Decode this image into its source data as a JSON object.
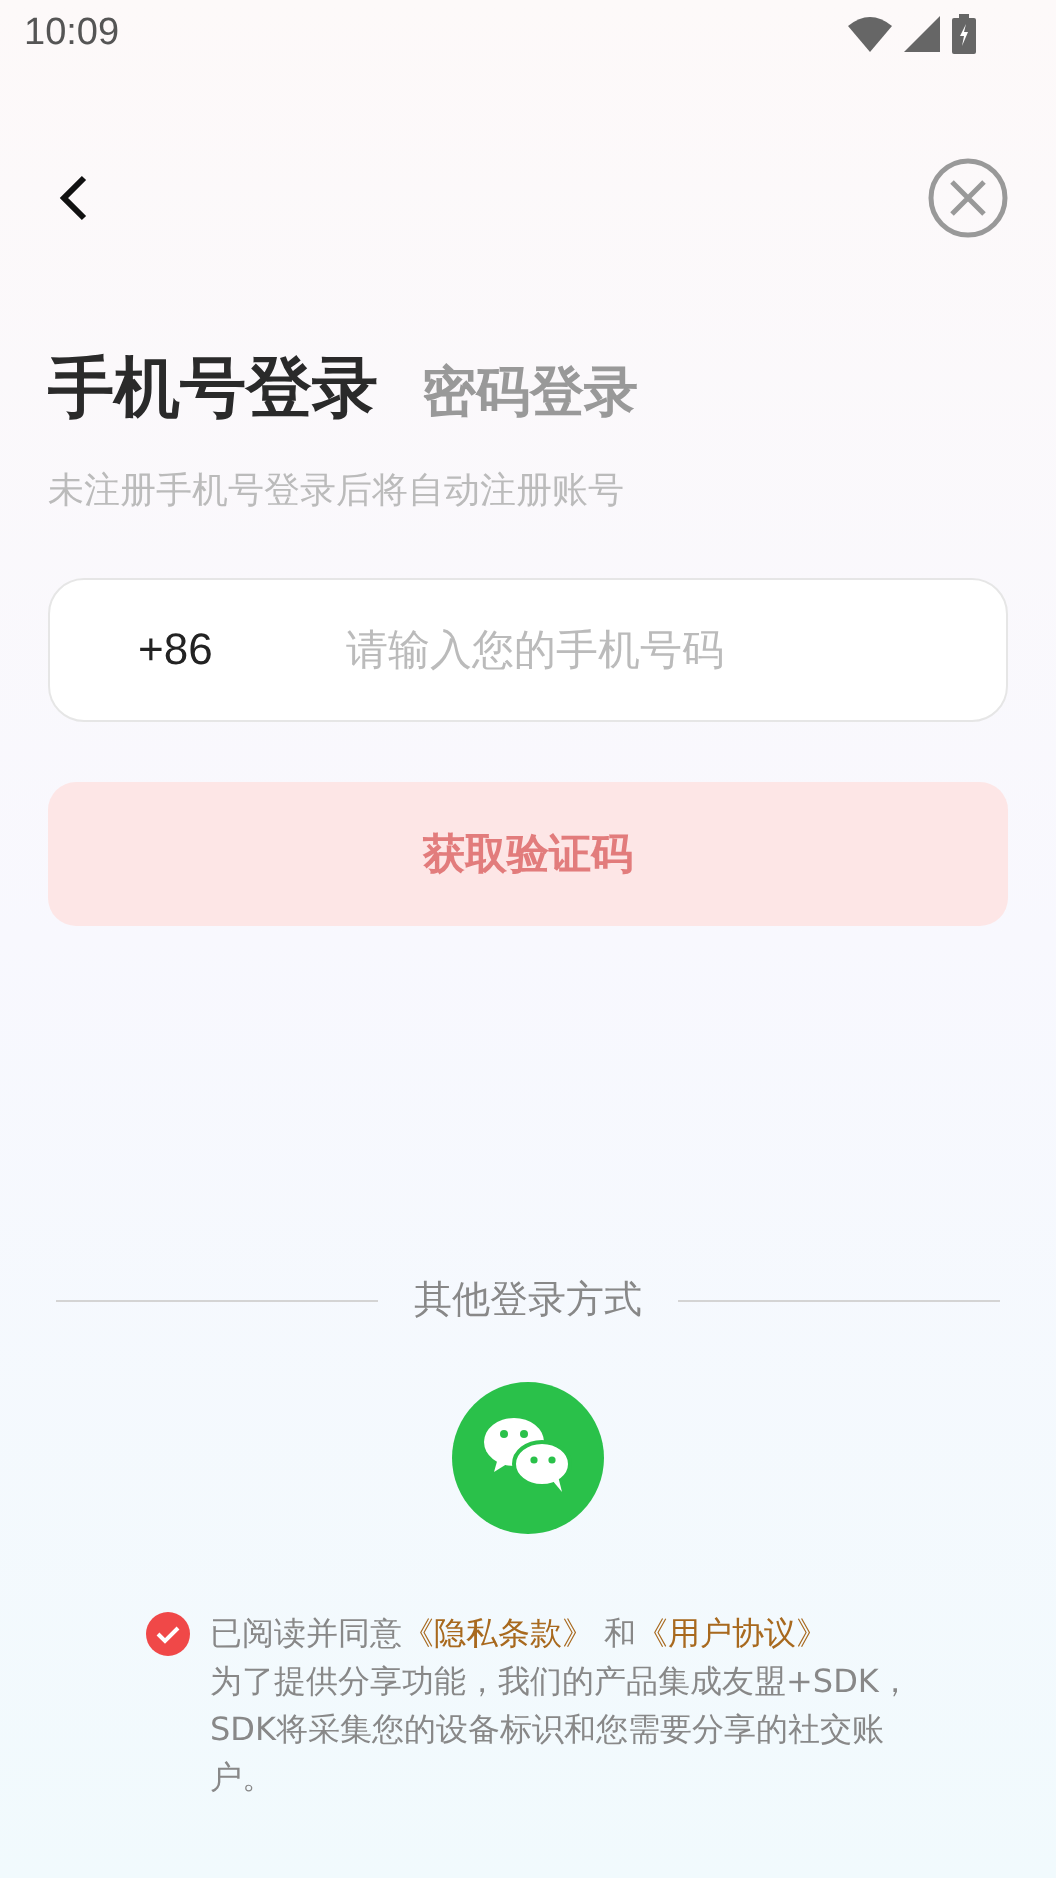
{
  "status_bar": {
    "time": "10:09"
  },
  "tabs": [
    {
      "label": "手机号登录",
      "selected": true
    },
    {
      "label": "密码登录",
      "selected": false
    }
  ],
  "hint": "未注册手机号登录后将自动注册账号",
  "phone_field": {
    "country_code": "+86",
    "placeholder": "请输入您的手机号码"
  },
  "get_code_button": {
    "label": "获取验证码",
    "disabled": true
  },
  "other_login": {
    "label": "其他登录方式"
  },
  "agreement": {
    "checked": true,
    "prefix": "已阅读并同意",
    "privacy_link": "《隐私条款》",
    "joiner": "和",
    "terms_link": "《用户协议》",
    "disclosure": "为了提供分享功能，我们的产品集成友盟+SDK，SDK将采集您的设备标识和您需要分享的社交账户。"
  }
}
